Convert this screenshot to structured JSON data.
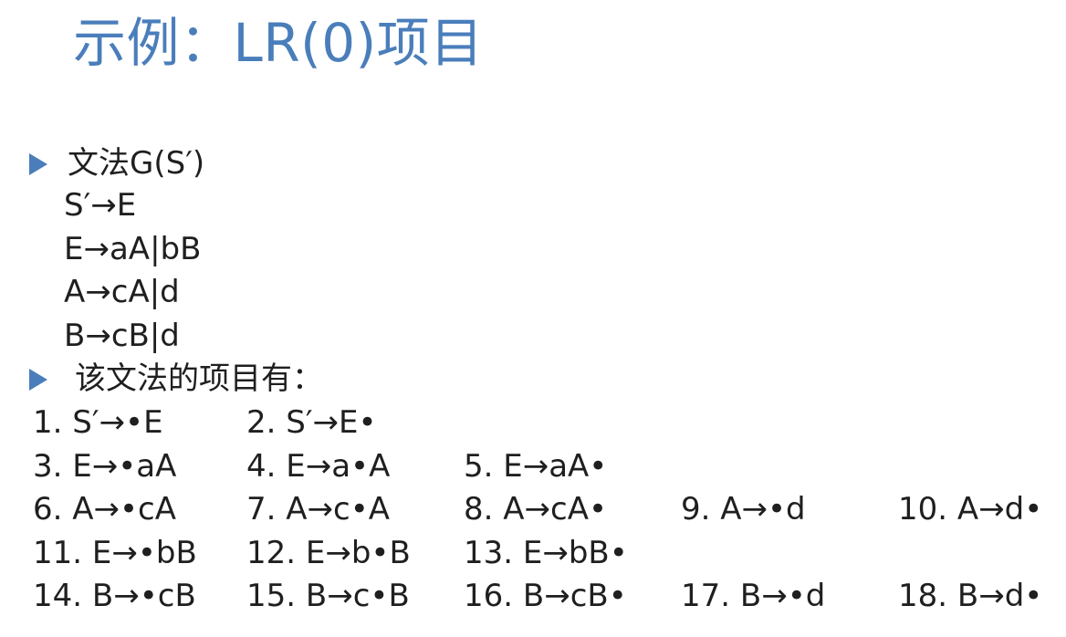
{
  "slide": {
    "title": "示例：LR(0)项目"
  },
  "grammar": {
    "bullet_label": "文法G(S′)",
    "rules": [
      "S′→E",
      "E→aA|bB",
      "A→cA|d",
      "B→cB|d"
    ]
  },
  "items_section": {
    "bullet_label": "该文法的项目有：",
    "rows": [
      [
        "1. S′→•E",
        "2. S′→E•",
        "",
        "",
        ""
      ],
      [
        "3. E→•aA",
        "4. E→a•A",
        "5. E→aA•",
        "",
        ""
      ],
      [
        "6. A→•cA",
        "7. A→c•A",
        "8. A→cA•",
        "9. A→•d",
        "10. A→d•"
      ],
      [
        "11. E→•bB",
        "12. E→b•B",
        "13. E→bB•",
        "",
        ""
      ],
      [
        "14. B→•cB",
        "15. B→c•B",
        "16. B→cB•",
        "17. B→•d",
        "18. B→d•"
      ]
    ]
  },
  "colors": {
    "accent": "#4a7ebb",
    "text": "#1f1f1f"
  }
}
